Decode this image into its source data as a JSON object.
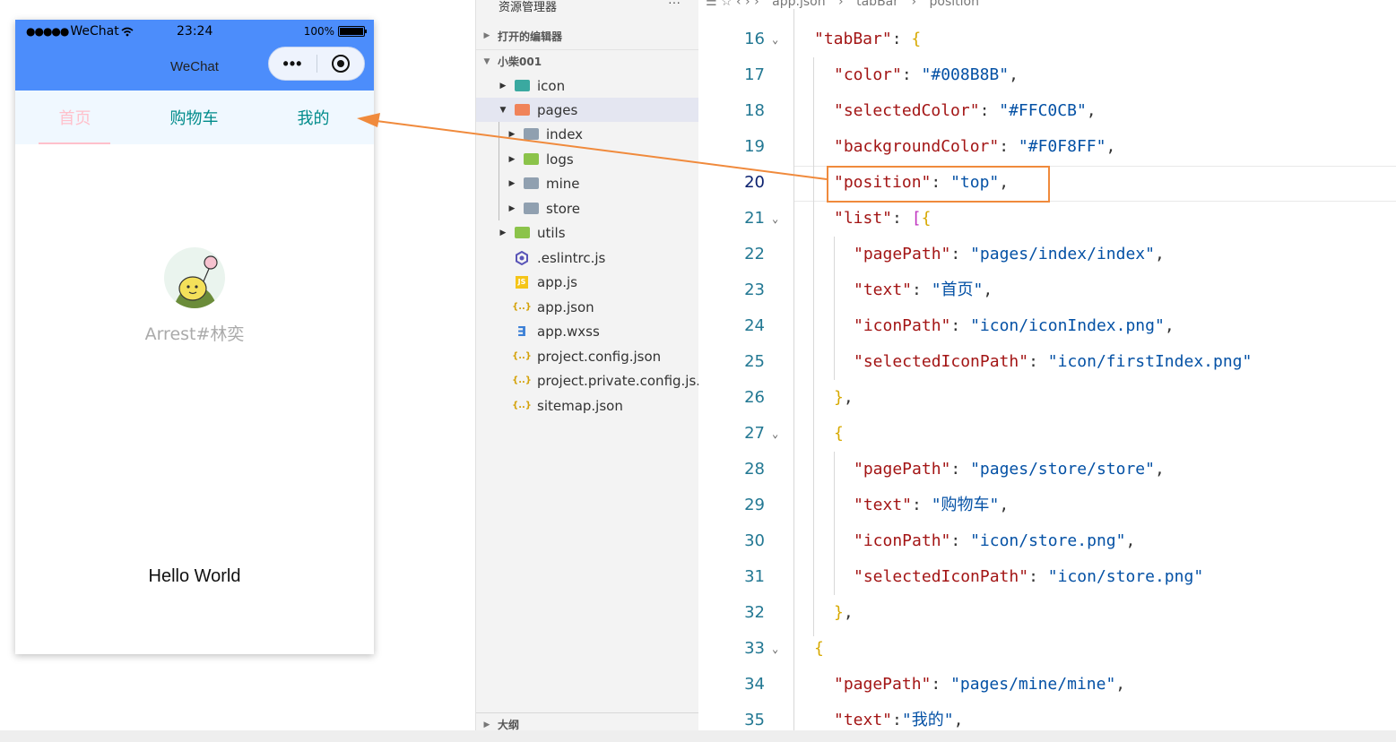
{
  "phone": {
    "status": {
      "carrier": "WeChat",
      "time": "23:24",
      "battery": "100%",
      "battery_level": 1.0
    },
    "nav_title": "WeChat",
    "capsule_more": "•••",
    "tabs": [
      {
        "label": "首页",
        "active": true
      },
      {
        "label": "购物车",
        "active": false
      },
      {
        "label": "我的",
        "active": false
      }
    ],
    "tab_colors": {
      "normal": "#008B8B",
      "selected": "#FFC0CB",
      "background": "#F0F8FF"
    },
    "nickname": "Arrest#林奕",
    "hello": "Hello World"
  },
  "explorer": {
    "title": "资源管理器",
    "more": "···",
    "sections": {
      "open_editors": "打开的编辑器",
      "project": "小柴001",
      "outline": "大纲"
    },
    "tree": [
      {
        "label": "icon",
        "kind": "folder-teal"
      },
      {
        "label": "pages",
        "kind": "folder-orange",
        "expanded": true
      },
      {
        "label": "index",
        "kind": "folder-gray"
      },
      {
        "label": "logs",
        "kind": "folder-green"
      },
      {
        "label": "mine",
        "kind": "folder-gray"
      },
      {
        "label": "store",
        "kind": "folder-gray"
      },
      {
        "label": "utils",
        "kind": "folder-green"
      },
      {
        "label": ".eslintrc.js",
        "kind": "eslint-icon"
      },
      {
        "label": "app.js",
        "kind": "js-icon"
      },
      {
        "label": "app.json",
        "kind": "json-icon"
      },
      {
        "label": "app.wxss",
        "kind": "css-icon"
      },
      {
        "label": "project.config.json",
        "kind": "json-icon"
      },
      {
        "label": "project.private.config.js...",
        "kind": "json-icon"
      },
      {
        "label": "sitemap.json",
        "kind": "json-icon"
      }
    ]
  },
  "editor": {
    "breadcrumb": [
      "app.json",
      "tabBar",
      "position"
    ],
    "current_line": 20,
    "lines": [
      {
        "n": "16",
        "text": "\"tabBar\": {"
      },
      {
        "n": "17",
        "text": "\"color\": \"#008B8B\","
      },
      {
        "n": "18",
        "text": "\"selectedColor\": \"#FFC0CB\","
      },
      {
        "n": "19",
        "text": "\"backgroundColor\": \"#F0F8FF\","
      },
      {
        "n": "20",
        "text": "\"position\": \"top\","
      },
      {
        "n": "21",
        "text": "\"list\": [{"
      },
      {
        "n": "22",
        "text": "\"pagePath\": \"pages/index/index\","
      },
      {
        "n": "23",
        "text": "\"text\": \"首页\","
      },
      {
        "n": "24",
        "text": "\"iconPath\": \"icon/iconIndex.png\","
      },
      {
        "n": "25",
        "text": "\"selectedIconPath\": \"icon/firstIndex.png\""
      },
      {
        "n": "26",
        "text": "},"
      },
      {
        "n": "27",
        "text": "{"
      },
      {
        "n": "28",
        "text": "\"pagePath\": \"pages/store/store\","
      },
      {
        "n": "29",
        "text": "\"text\": \"购物车\","
      },
      {
        "n": "30",
        "text": "\"iconPath\": \"icon/store.png\","
      },
      {
        "n": "31",
        "text": "\"selectedIconPath\": \"icon/store.png\""
      },
      {
        "n": "32",
        "text": "},"
      },
      {
        "n": "33",
        "text": "{"
      },
      {
        "n": "34",
        "text": "\"pagePath\": \"pages/mine/mine\","
      },
      {
        "n": "35",
        "text": "\"text\":\"我的\","
      }
    ]
  },
  "colors": {
    "accent": "#4C8DFB",
    "highlight": "#F08A3C"
  }
}
